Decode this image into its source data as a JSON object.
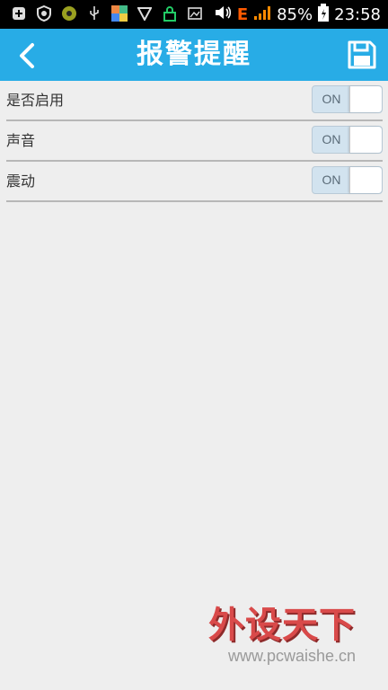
{
  "status_bar": {
    "icons": [
      "notification-plus-icon",
      "shield-icon",
      "app-icon",
      "usb-icon",
      "photo-app-icon",
      "vpn-icon",
      "lock-icon",
      "image-icon"
    ],
    "network": "E",
    "battery": "85%",
    "time": "23:58"
  },
  "header": {
    "title": "报警提醒",
    "back_icon": "chevron-left-icon",
    "save_icon": "floppy-disk-icon",
    "bg_color": "#28ace6"
  },
  "settings": [
    {
      "label": "是否启用",
      "toggle": "ON"
    },
    {
      "label": "声音",
      "toggle": "ON"
    },
    {
      "label": "震动",
      "toggle": "ON"
    }
  ],
  "watermark": {
    "logo": "外设天下",
    "url": "www.pcwaishe.cn"
  }
}
